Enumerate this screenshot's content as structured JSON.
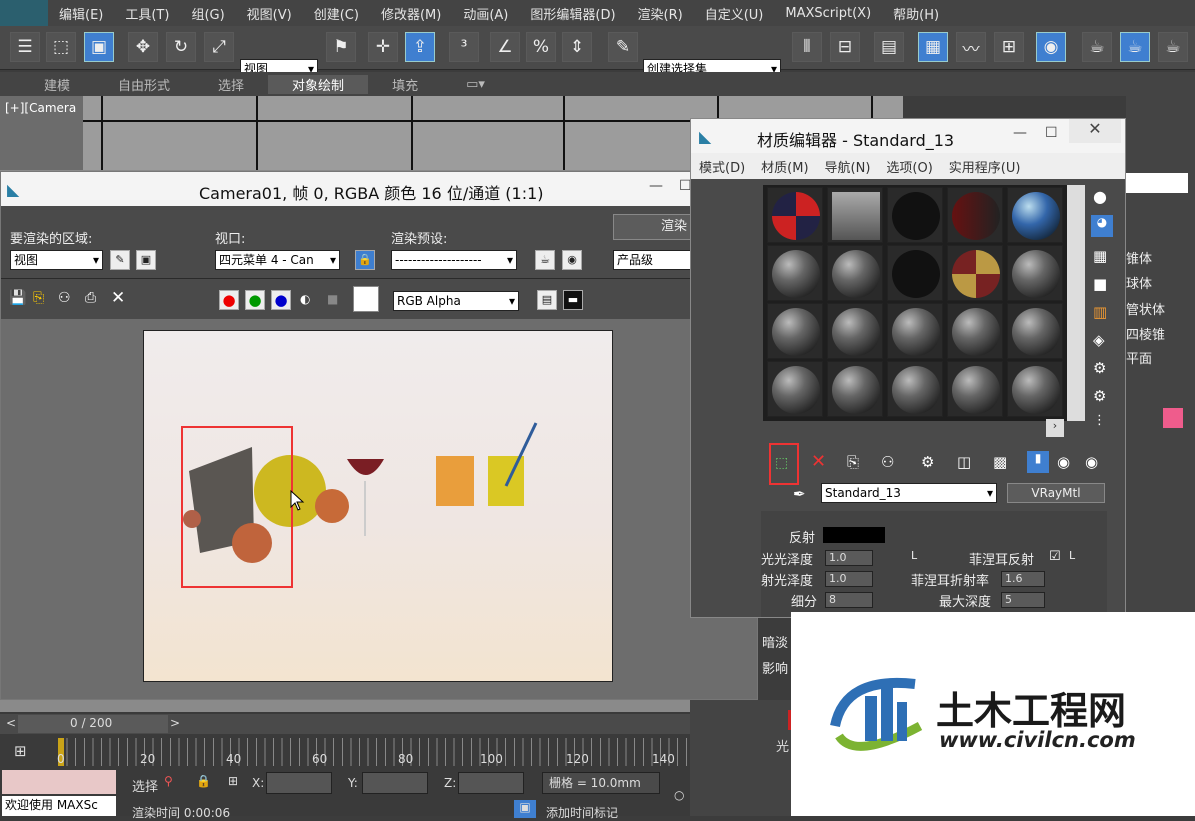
{
  "menubar": {
    "items": [
      "编辑(E)",
      "工具(T)",
      "组(G)",
      "视图(V)",
      "创建(C)",
      "修改器(M)",
      "动画(A)",
      "图形编辑器(D)",
      "渲染(R)",
      "自定义(U)",
      "MAXScript(X)",
      "帮助(H)"
    ]
  },
  "toolbar": {
    "view_select": "视图",
    "selection_set": "创建选择集"
  },
  "ribbon": {
    "tabs": [
      "建模",
      "自由形式",
      "选择",
      "对象绘制",
      "填充"
    ]
  },
  "viewport": {
    "label": "[+][Camera"
  },
  "framewin": {
    "title": "Camera01, 帧 0, RGBA 颜色 16 位/通道 (1:1)",
    "area_label": "要渲染的区域:",
    "area_value": "视图",
    "viewport_label": "视口:",
    "viewport_value": "四元菜单 4 - Can",
    "preset_label": "渲染预设:",
    "preset_value": "--------------------",
    "render_button": "渲染",
    "quality_value": "产品级",
    "channel_value": "RGB Alpha"
  },
  "mateditor": {
    "title": "材质编辑器 - Standard_13",
    "menu": [
      "模式(D)",
      "材质(M)",
      "导航(N)",
      "选项(O)",
      "实用程序(U)"
    ],
    "material_name": "Standard_13",
    "material_type": "VRayMtl",
    "params": {
      "reflect": "反射",
      "gloss": "光光泽度",
      "gloss_val": "1.0",
      "fresnel": "菲涅耳反射",
      "refr_gloss": "射光泽度",
      "refr_gloss_val": "1.0",
      "fresnel_ior": "菲涅耳折射率",
      "fresnel_ior_val": "1.6",
      "subdiv": "细分",
      "subdiv_val": "8",
      "maxdepth": "最大深度",
      "maxdepth_val": "5",
      "dim": "暗淡",
      "affect": "影响"
    },
    "lock": "L"
  },
  "cmdpanel": {
    "items": [
      "锥体",
      "球体",
      "管状体",
      "四棱锥",
      "平面"
    ]
  },
  "timeline": {
    "frame": "0 / 200",
    "ticks": [
      "0",
      "20",
      "40",
      "60",
      "80",
      "100",
      "120",
      "140"
    ],
    "welcome": "欢迎使用 MAXSc",
    "select": "选择",
    "x_label": "X:",
    "y_label": "Y:",
    "z_label": "Z:",
    "grid": "栅格 = 10.0mm",
    "render_time": "渲染时间 0:00:06",
    "add_time": "添加时间标记",
    "light": "光"
  },
  "watermark": {
    "text": "土木工程网",
    "url": "www.civilcn.com"
  },
  "colors": {
    "accent": "#3f7fd0",
    "redbox": "#e33",
    "swatch": "#ef5c8c"
  }
}
